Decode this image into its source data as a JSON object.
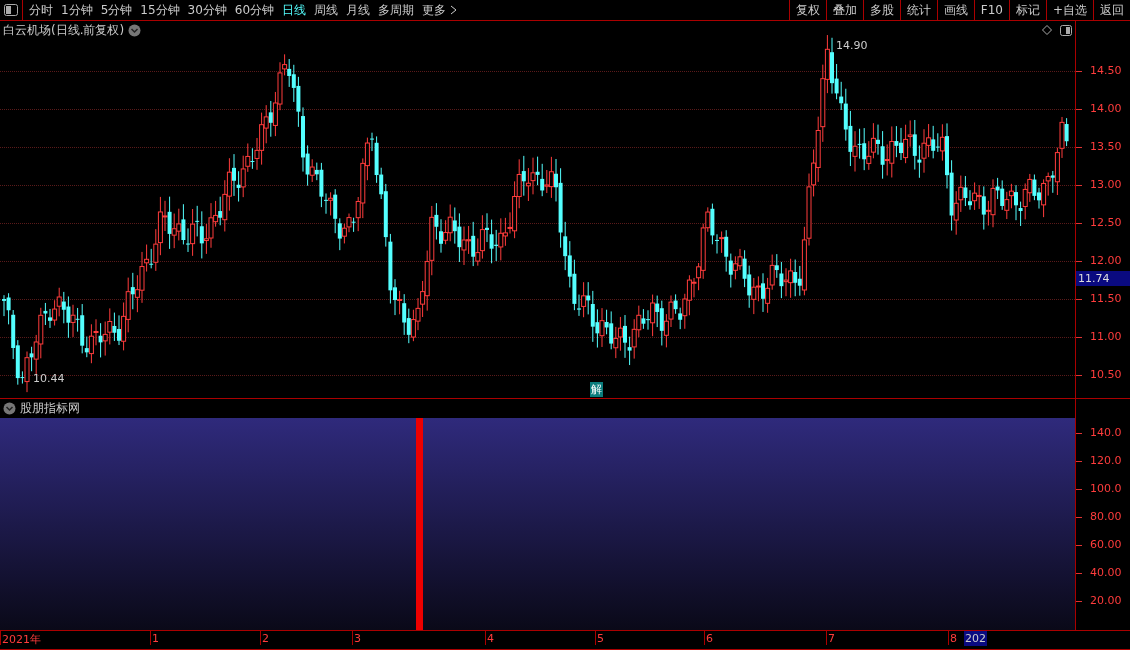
{
  "toolbar": {
    "periods": [
      {
        "label": "分时",
        "selected": false
      },
      {
        "label": "1分钟",
        "selected": false
      },
      {
        "label": "5分钟",
        "selected": false
      },
      {
        "label": "15分钟",
        "selected": false
      },
      {
        "label": "30分钟",
        "selected": false
      },
      {
        "label": "60分钟",
        "selected": false
      },
      {
        "label": "日线",
        "selected": true
      },
      {
        "label": "周线",
        "selected": false
      },
      {
        "label": "月线",
        "selected": false
      },
      {
        "label": "多周期",
        "selected": false
      }
    ],
    "more": "更多",
    "actions": [
      "复权",
      "叠加",
      "多股",
      "统计",
      "画线",
      "F10",
      "标记",
      "+自选",
      "返回"
    ]
  },
  "chart": {
    "title": "白云机场(日线.前复权)",
    "high_label": "14.90",
    "low_label": "10.44",
    "current_price": "11.74",
    "marker": "解",
    "y_ticks": [
      "14.50",
      "14.00",
      "13.50",
      "13.00",
      "12.50",
      "12.00",
      "11.50",
      "11.00",
      "10.50"
    ]
  },
  "indicator": {
    "title": "股朋指标网",
    "y_ticks": [
      "140.0",
      "120.0",
      "100.0",
      "80.00",
      "60.00",
      "40.00",
      "20.00"
    ]
  },
  "date_axis": {
    "labels": [
      "2021年",
      "1",
      "2",
      "3",
      "4",
      "5",
      "6",
      "7",
      "8"
    ],
    "next_year": "202"
  }
}
